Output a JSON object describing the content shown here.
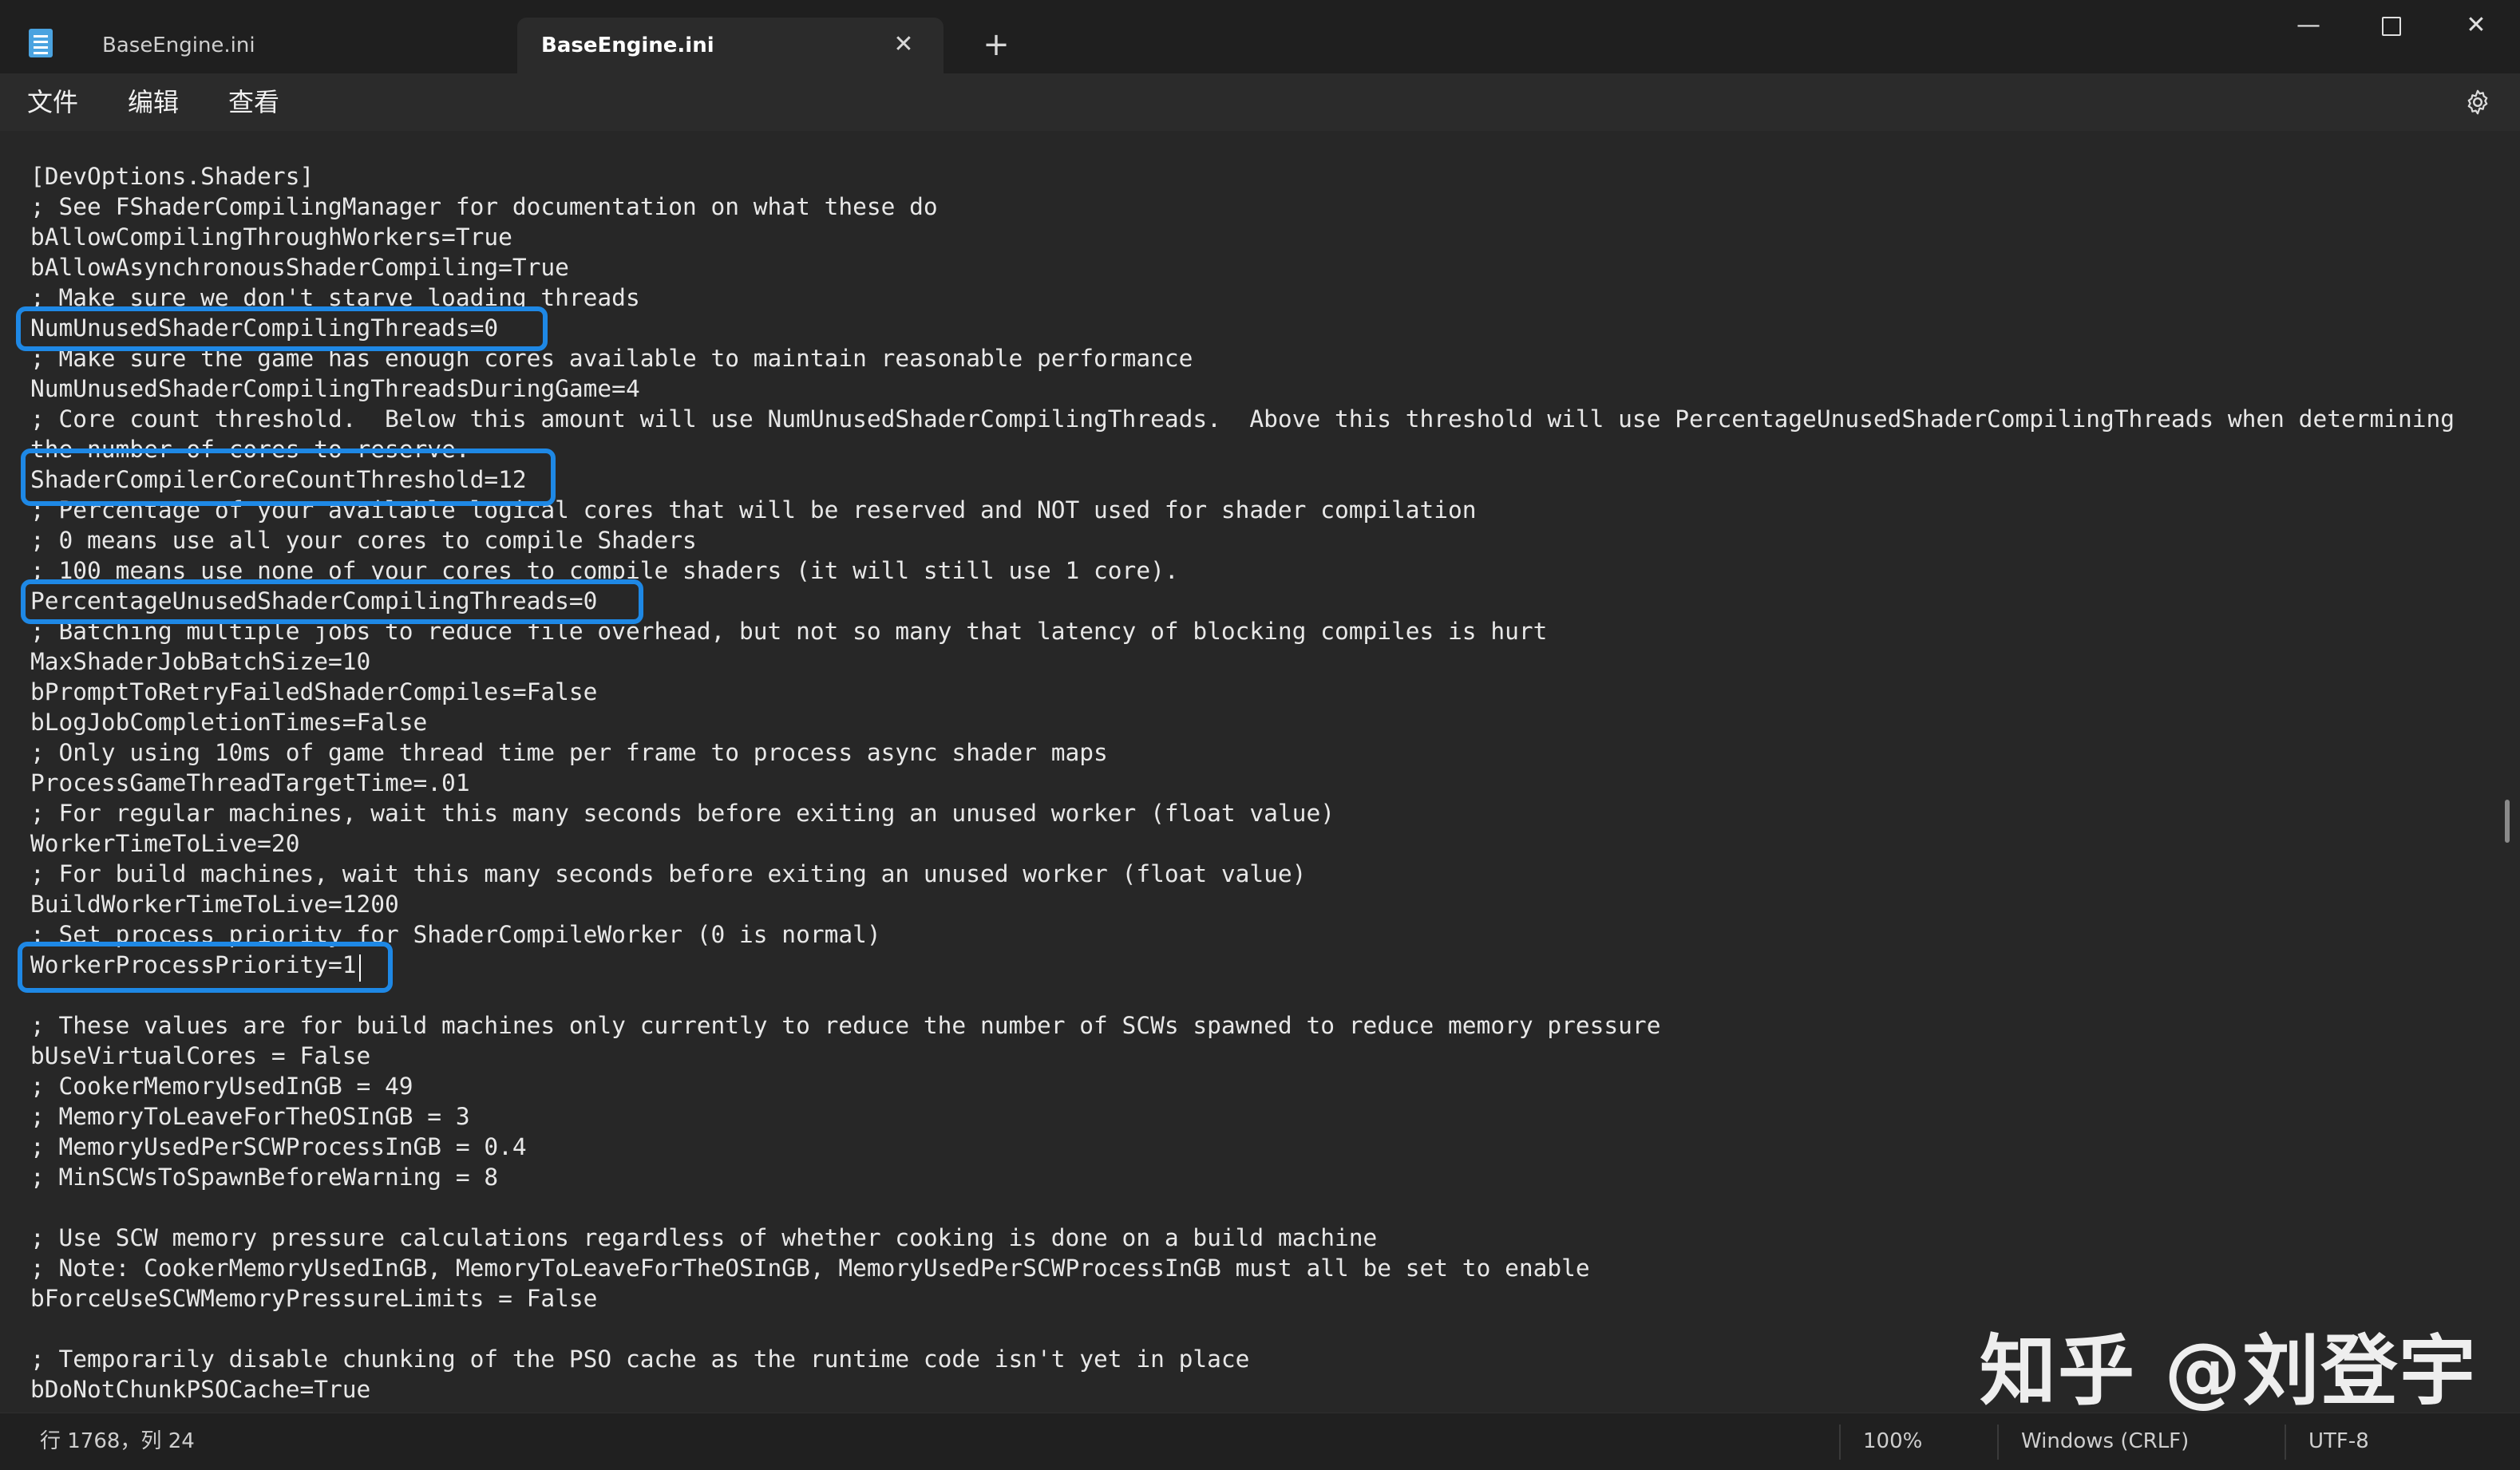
{
  "window": {
    "tabs": [
      {
        "label": "BaseEngine.ini",
        "active": false
      },
      {
        "label": "BaseEngine.ini",
        "active": true
      }
    ],
    "tab_close_glyph": "✕",
    "new_tab_glyph": "+",
    "minimize_glyph": "—",
    "close_glyph": "✕"
  },
  "menu": {
    "file": "文件",
    "edit": "编辑",
    "view": "查看",
    "settings_icon": "gear-icon"
  },
  "editor": {
    "lines": [
      "[DevOptions.Shaders]",
      "; See FShaderCompilingManager for documentation on what these do",
      "bAllowCompilingThroughWorkers=True",
      "bAllowAsynchronousShaderCompiling=True",
      "; Make sure we don't starve loading threads",
      "NumUnusedShaderCompilingThreads=0",
      "; Make sure the game has enough cores available to maintain reasonable performance",
      "NumUnusedShaderCompilingThreadsDuringGame=4",
      "; Core count threshold.  Below this amount will use NumUnusedShaderCompilingThreads.  Above this threshold will use PercentageUnusedShaderCompilingThreads when determining",
      "the number of cores to reserve.",
      "ShaderCompilerCoreCountThreshold=12",
      "; Percentage of your available logical cores that will be reserved and NOT used for shader compilation",
      "; 0 means use all your cores to compile Shaders",
      "; 100 means use none of your cores to compile shaders (it will still use 1 core).",
      "PercentageUnusedShaderCompilingThreads=0",
      "; Batching multiple jobs to reduce file overhead, but not so many that latency of blocking compiles is hurt",
      "MaxShaderJobBatchSize=10",
      "bPromptToRetryFailedShaderCompiles=False",
      "bLogJobCompletionTimes=False",
      "; Only using 10ms of game thread time per frame to process async shader maps",
      "ProcessGameThreadTargetTime=.01",
      "; For regular machines, wait this many seconds before exiting an unused worker (float value)",
      "WorkerTimeToLive=20",
      "; For build machines, wait this many seconds before exiting an unused worker (float value)",
      "BuildWorkerTimeToLive=1200",
      "; Set process priority for ShaderCompileWorker (0 is normal)",
      "WorkerProcessPriority=1",
      "",
      "; These values are for build machines only currently to reduce the number of SCWs spawned to reduce memory pressure",
      "bUseVirtualCores = False",
      "; CookerMemoryUsedInGB = 49",
      "; MemoryToLeaveForTheOSInGB = 3",
      "; MemoryUsedPerSCWProcessInGB = 0.4",
      "; MinSCWsToSpawnBeforeWarning = 8",
      "",
      "; Use SCW memory pressure calculations regardless of whether cooking is done on a build machine",
      "; Note: CookerMemoryUsedInGB, MemoryToLeaveForTheOSInGB, MemoryUsedPerSCWProcessInGB must all be set to enable",
      "bForceUseSCWMemoryPressureLimits = False",
      "",
      "; Temporarily disable chunking of the PSO cache as the runtime code isn't yet in place",
      "bDoNotChunkPSOCache=True"
    ],
    "highlight_color": "#1e88e5"
  },
  "watermark": "知乎 @刘登宇",
  "status": {
    "position": "行 1768，列 24",
    "zoom": "100%",
    "line_ending": "Windows (CRLF)",
    "encoding": "UTF-8"
  }
}
